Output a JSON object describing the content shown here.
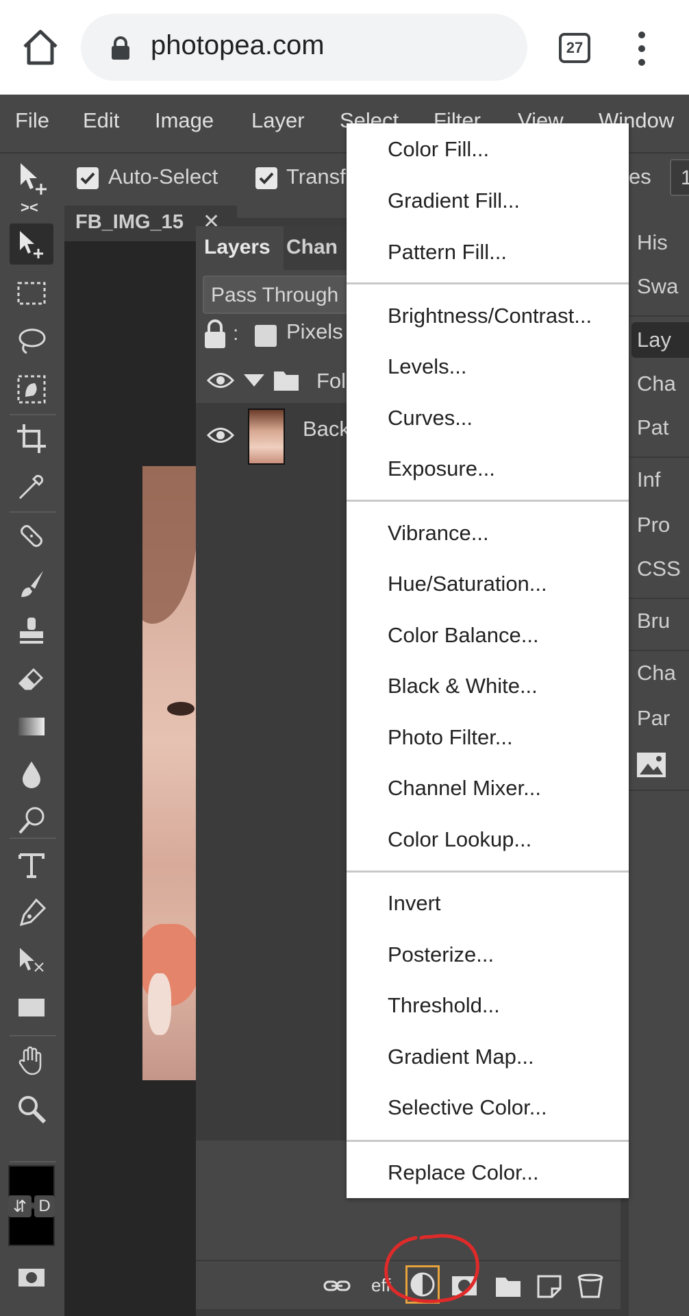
{
  "browser": {
    "url": "photopea.com",
    "tab_count": "27"
  },
  "menubar": {
    "items": [
      "File",
      "Edit",
      "Image",
      "Layer",
      "Select",
      "Filter",
      "View",
      "Window"
    ]
  },
  "options_bar": {
    "auto_select_label": "Auto-Select",
    "transform_label": "Transf",
    "trailing_label": "es",
    "trailing_number": "1"
  },
  "panel_strip": {
    "collapse_left": "><",
    "expand_right": "<>"
  },
  "document": {
    "tab_title": "FB_IMG_15",
    "tab_close": "✕"
  },
  "layers_panel": {
    "tab_layers": "Layers",
    "tab_channels": "Chan",
    "blend_mode": "Pass Through",
    "lock_colon": ":",
    "lock_pixels_label": "Pixels",
    "layers": [
      {
        "name": "Fol",
        "type": "folder"
      },
      {
        "name": "Back",
        "type": "image"
      }
    ],
    "bottom_fx_label": "eff"
  },
  "right_panel": {
    "items": [
      "His",
      "Swa",
      "Lay",
      "Cha",
      "Pat",
      "Inf",
      "Pro",
      "CSS",
      "Bru",
      "Cha",
      "Par"
    ]
  },
  "dropdown": {
    "groups": [
      [
        "Color Fill...",
        "Gradient Fill...",
        "Pattern Fill..."
      ],
      [
        "Brightness/Contrast...",
        "Levels...",
        "Curves...",
        "Exposure..."
      ],
      [
        "Vibrance...",
        "Hue/Saturation...",
        "Color Balance...",
        "Black & White...",
        "Photo Filter...",
        "Channel Mixer...",
        "Color Lookup..."
      ],
      [
        "Invert",
        "Posterize...",
        "Threshold...",
        "Gradient Map...",
        "Selective Color..."
      ],
      [
        "Replace Color..."
      ]
    ]
  },
  "toolbar": {
    "swap_label": "⇵",
    "default_label": "D"
  },
  "colors": {
    "accent_highlight": "#e8a33c",
    "annotation_red": "#e02a2a",
    "panel_bg": "#474747",
    "menu_bg": "#ffffff"
  }
}
